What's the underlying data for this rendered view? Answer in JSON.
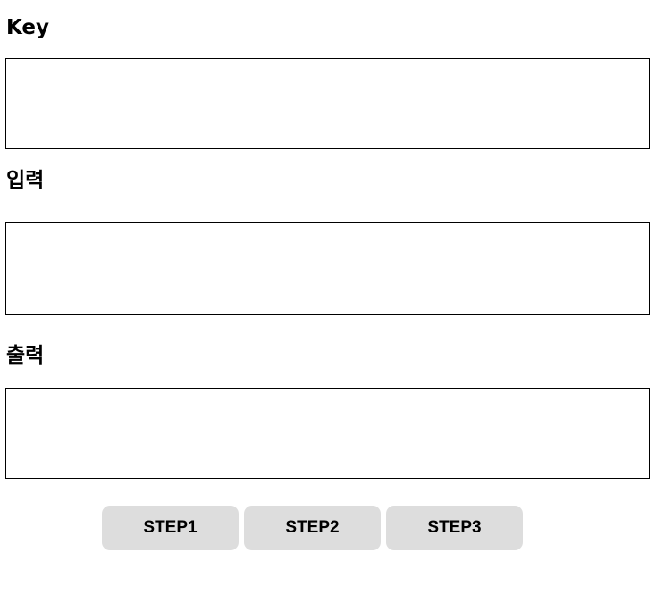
{
  "fields": {
    "key": {
      "label": "Key",
      "value": ""
    },
    "input": {
      "label": "입력",
      "value": ""
    },
    "output": {
      "label": "출력",
      "value": ""
    }
  },
  "buttons": {
    "step1": "STEP1",
    "step2": "STEP2",
    "step3": "STEP3"
  },
  "colors": {
    "button_bg": "#dddddd",
    "border": "#000000",
    "background": "#ffffff"
  }
}
